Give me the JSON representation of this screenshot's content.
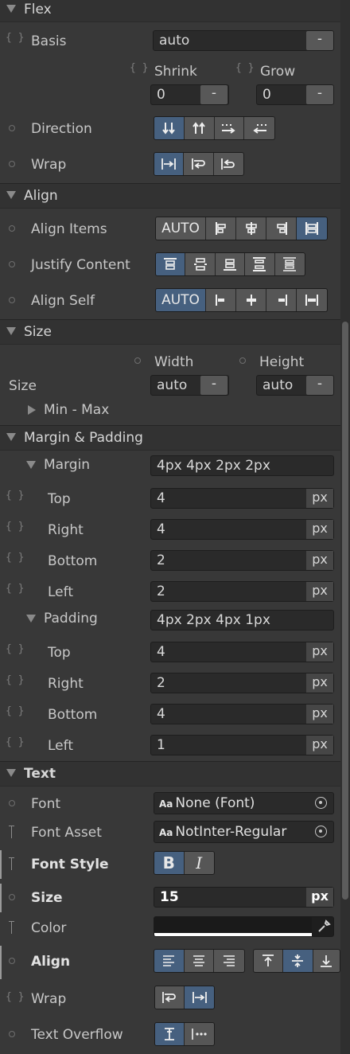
{
  "flex": {
    "title": "Flex",
    "basis_label": "Basis",
    "basis_value": "auto",
    "dash": "-",
    "shrink_label": "Shrink",
    "shrink_value": "0",
    "grow_label": "Grow",
    "grow_value": "0",
    "direction_label": "Direction",
    "direction_options": [
      "column",
      "column-reverse",
      "row",
      "row-reverse"
    ],
    "direction_selected": "column",
    "wrap_label": "Wrap",
    "wrap_options": [
      "nowrap",
      "wrap",
      "wrap-reverse"
    ],
    "wrap_selected": "nowrap"
  },
  "align": {
    "title": "Align",
    "align_items_label": "Align Items",
    "align_items_auto": "AUTO",
    "align_items_selected": "stretch",
    "justify_content_label": "Justify Content",
    "justify_content_selected": "flex-start",
    "align_self_label": "Align Self",
    "align_self_auto": "AUTO",
    "align_self_selected": "auto"
  },
  "size": {
    "title": "Size",
    "size_label": "Size",
    "width_label": "Width",
    "width_value": "auto",
    "height_label": "Height",
    "height_value": "auto",
    "minmax_label": "Min - Max"
  },
  "spacing": {
    "title": "Margin & Padding",
    "margin_label": "Margin",
    "margin_value": "4px 4px 2px 2px",
    "padding_label": "Padding",
    "padding_value": "4px 2px 4px 1px",
    "unit": "px",
    "margin_rows": [
      {
        "label": "Top",
        "value": "4"
      },
      {
        "label": "Right",
        "value": "4"
      },
      {
        "label": "Bottom",
        "value": "2"
      },
      {
        "label": "Left",
        "value": "2"
      }
    ],
    "padding_rows": [
      {
        "label": "Top",
        "value": "4"
      },
      {
        "label": "Right",
        "value": "2"
      },
      {
        "label": "Bottom",
        "value": "4"
      },
      {
        "label": "Left",
        "value": "1"
      }
    ]
  },
  "text": {
    "title": "Text",
    "font_label": "Font",
    "font_value": "None (Font)",
    "font_asset_label": "Font Asset",
    "font_asset_value": "NotInter-Regular",
    "aa_glyph": "Aa",
    "font_style_label": "Font Style",
    "bold_glyph": "B",
    "italic_glyph": "I",
    "bold_active": true,
    "size_label": "Size",
    "size_value": "15",
    "size_unit": "px",
    "color_label": "Color",
    "color_value": "#ffffff",
    "align_label": "Align",
    "align_h_selected": "left",
    "align_v_selected": "middle",
    "wrap_label": "Wrap",
    "wrap_selected": "nowrap",
    "overflow_label": "Text Overflow",
    "overflow_selected": "clip"
  },
  "colors": {
    "accent": "#46607f",
    "panel": "#383838",
    "header": "#323232"
  }
}
